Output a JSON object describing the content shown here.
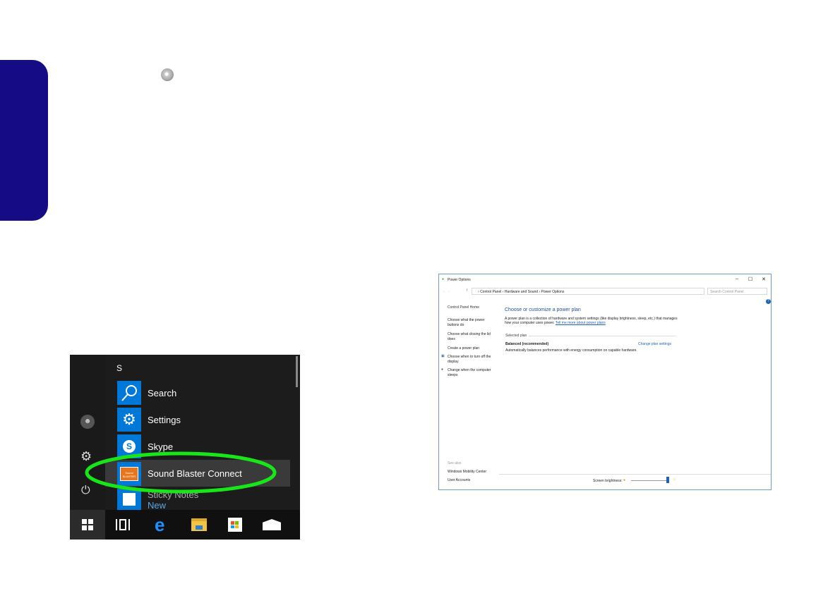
{
  "start_menu": {
    "section_letter": "S",
    "apps": [
      {
        "label": "Search",
        "icon": "search-icon"
      },
      {
        "label": "Settings",
        "icon": "gear-icon"
      },
      {
        "label": "Skype",
        "icon": "skype-icon"
      },
      {
        "label": "Sound Blaster Connect",
        "icon": "sound-blaster-icon",
        "highlighted": true
      },
      {
        "label": "Sticky Notes",
        "icon": "sticky-notes-icon",
        "badge": "New"
      }
    ],
    "sound_blaster_tile_text": "Sound BLASTER",
    "highlight_color": "#19e619"
  },
  "power_options": {
    "title": "Power Options",
    "window_controls": [
      "–",
      "☐",
      "✕"
    ],
    "breadcrumb": [
      "Control Panel",
      "Hardware and Sound",
      "Power Options"
    ],
    "search_placeholder": "Search Control Panel",
    "sidebar": [
      "Control Panel Home",
      "Choose what the power buttons do",
      "Choose what closing the lid does",
      "Create a power plan",
      "Choose when to turn off the display",
      "Change when the computer sleeps"
    ],
    "heading": "Choose or customize a power plan",
    "description": "A power plan is a collection of hardware and system settings (like display brightness, sleep, etc.) that manages how your computer uses power.",
    "learn_link": "Tell me more about power plans",
    "selected_plan_label": "Selected plan",
    "plan_name": "Balanced (recommended)",
    "plan_desc": "Automatically balances performance with energy consumption on capable hardware.",
    "change_link": "Change plan settings",
    "see_also": "See also",
    "see_also_links": [
      "Windows Mobility Center",
      "User Accounts"
    ],
    "brightness_label": "Screen brightness:",
    "brightness_level": 1.0
  }
}
